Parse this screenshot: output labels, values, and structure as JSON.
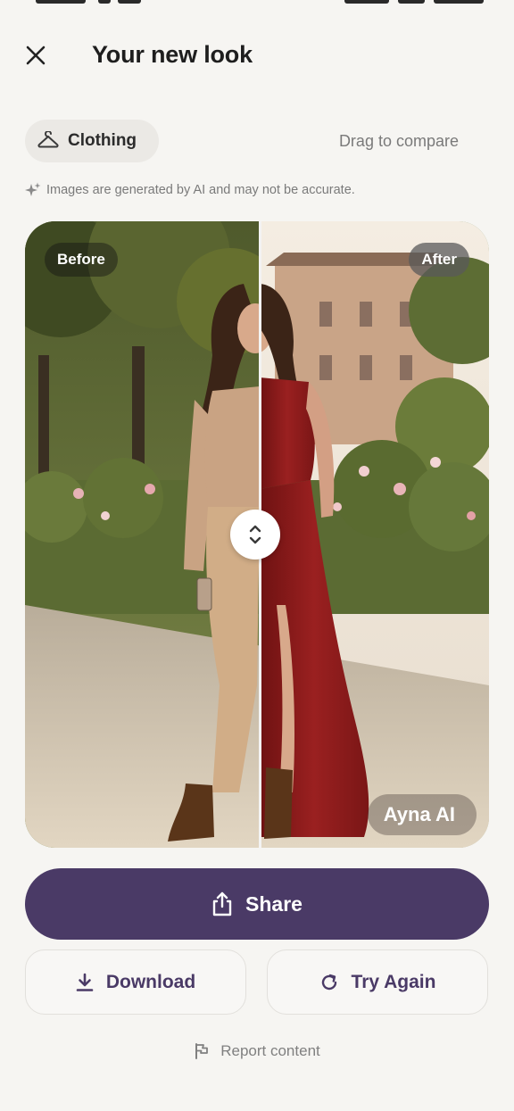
{
  "header": {
    "title": "Your new look",
    "close_icon": "close-icon"
  },
  "filter_chip": {
    "label": "Clothing",
    "icon": "hanger-icon"
  },
  "drag_hint": "Drag to compare",
  "disclaimer": {
    "text": "Images are generated by AI and may not be accurate.",
    "icon": "sparkle-icon"
  },
  "comparison": {
    "before_label": "Before",
    "after_label": "After",
    "watermark": "Ayna AI",
    "handle_icon": "chevron-up-down-icon"
  },
  "actions": {
    "share_label": "Share",
    "download_label": "Download",
    "try_again_label": "Try Again"
  },
  "report": {
    "label": "Report content",
    "icon": "flag-icon"
  },
  "colors": {
    "primary": "#4a3a66",
    "background": "#f6f5f2",
    "chip_bg": "#ebe9e5",
    "muted_text": "#7a7a7a",
    "dress_red": "#8e1c1c",
    "sweater_beige": "#c9a383"
  }
}
